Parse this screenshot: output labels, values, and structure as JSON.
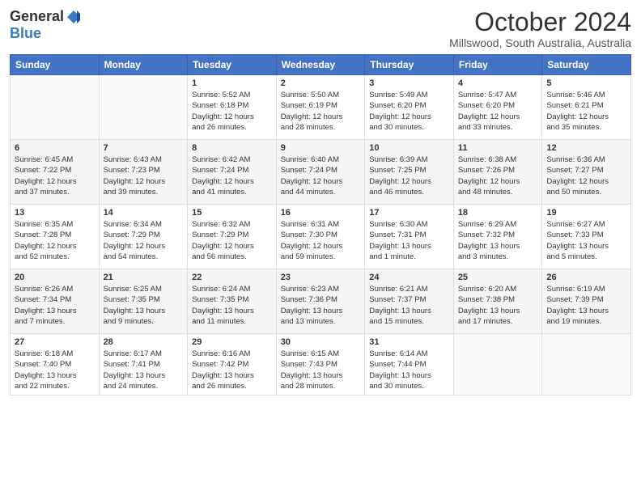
{
  "logo": {
    "general": "General",
    "blue": "Blue"
  },
  "title": "October 2024",
  "location": "Millswood, South Australia, Australia",
  "days_of_week": [
    "Sunday",
    "Monday",
    "Tuesday",
    "Wednesday",
    "Thursday",
    "Friday",
    "Saturday"
  ],
  "weeks": [
    [
      {
        "day": "",
        "info": ""
      },
      {
        "day": "",
        "info": ""
      },
      {
        "day": "1",
        "info": "Sunrise: 5:52 AM\nSunset: 6:18 PM\nDaylight: 12 hours\nand 26 minutes."
      },
      {
        "day": "2",
        "info": "Sunrise: 5:50 AM\nSunset: 6:19 PM\nDaylight: 12 hours\nand 28 minutes."
      },
      {
        "day": "3",
        "info": "Sunrise: 5:49 AM\nSunset: 6:20 PM\nDaylight: 12 hours\nand 30 minutes."
      },
      {
        "day": "4",
        "info": "Sunrise: 5:47 AM\nSunset: 6:20 PM\nDaylight: 12 hours\nand 33 minutes."
      },
      {
        "day": "5",
        "info": "Sunrise: 5:46 AM\nSunset: 6:21 PM\nDaylight: 12 hours\nand 35 minutes."
      }
    ],
    [
      {
        "day": "6",
        "info": "Sunrise: 6:45 AM\nSunset: 7:22 PM\nDaylight: 12 hours\nand 37 minutes."
      },
      {
        "day": "7",
        "info": "Sunrise: 6:43 AM\nSunset: 7:23 PM\nDaylight: 12 hours\nand 39 minutes."
      },
      {
        "day": "8",
        "info": "Sunrise: 6:42 AM\nSunset: 7:24 PM\nDaylight: 12 hours\nand 41 minutes."
      },
      {
        "day": "9",
        "info": "Sunrise: 6:40 AM\nSunset: 7:24 PM\nDaylight: 12 hours\nand 44 minutes."
      },
      {
        "day": "10",
        "info": "Sunrise: 6:39 AM\nSunset: 7:25 PM\nDaylight: 12 hours\nand 46 minutes."
      },
      {
        "day": "11",
        "info": "Sunrise: 6:38 AM\nSunset: 7:26 PM\nDaylight: 12 hours\nand 48 minutes."
      },
      {
        "day": "12",
        "info": "Sunrise: 6:36 AM\nSunset: 7:27 PM\nDaylight: 12 hours\nand 50 minutes."
      }
    ],
    [
      {
        "day": "13",
        "info": "Sunrise: 6:35 AM\nSunset: 7:28 PM\nDaylight: 12 hours\nand 52 minutes."
      },
      {
        "day": "14",
        "info": "Sunrise: 6:34 AM\nSunset: 7:29 PM\nDaylight: 12 hours\nand 54 minutes."
      },
      {
        "day": "15",
        "info": "Sunrise: 6:32 AM\nSunset: 7:29 PM\nDaylight: 12 hours\nand 56 minutes."
      },
      {
        "day": "16",
        "info": "Sunrise: 6:31 AM\nSunset: 7:30 PM\nDaylight: 12 hours\nand 59 minutes."
      },
      {
        "day": "17",
        "info": "Sunrise: 6:30 AM\nSunset: 7:31 PM\nDaylight: 13 hours\nand 1 minute."
      },
      {
        "day": "18",
        "info": "Sunrise: 6:29 AM\nSunset: 7:32 PM\nDaylight: 13 hours\nand 3 minutes."
      },
      {
        "day": "19",
        "info": "Sunrise: 6:27 AM\nSunset: 7:33 PM\nDaylight: 13 hours\nand 5 minutes."
      }
    ],
    [
      {
        "day": "20",
        "info": "Sunrise: 6:26 AM\nSunset: 7:34 PM\nDaylight: 13 hours\nand 7 minutes."
      },
      {
        "day": "21",
        "info": "Sunrise: 6:25 AM\nSunset: 7:35 PM\nDaylight: 13 hours\nand 9 minutes."
      },
      {
        "day": "22",
        "info": "Sunrise: 6:24 AM\nSunset: 7:35 PM\nDaylight: 13 hours\nand 11 minutes."
      },
      {
        "day": "23",
        "info": "Sunrise: 6:23 AM\nSunset: 7:36 PM\nDaylight: 13 hours\nand 13 minutes."
      },
      {
        "day": "24",
        "info": "Sunrise: 6:21 AM\nSunset: 7:37 PM\nDaylight: 13 hours\nand 15 minutes."
      },
      {
        "day": "25",
        "info": "Sunrise: 6:20 AM\nSunset: 7:38 PM\nDaylight: 13 hours\nand 17 minutes."
      },
      {
        "day": "26",
        "info": "Sunrise: 6:19 AM\nSunset: 7:39 PM\nDaylight: 13 hours\nand 19 minutes."
      }
    ],
    [
      {
        "day": "27",
        "info": "Sunrise: 6:18 AM\nSunset: 7:40 PM\nDaylight: 13 hours\nand 22 minutes."
      },
      {
        "day": "28",
        "info": "Sunrise: 6:17 AM\nSunset: 7:41 PM\nDaylight: 13 hours\nand 24 minutes."
      },
      {
        "day": "29",
        "info": "Sunrise: 6:16 AM\nSunset: 7:42 PM\nDaylight: 13 hours\nand 26 minutes."
      },
      {
        "day": "30",
        "info": "Sunrise: 6:15 AM\nSunset: 7:43 PM\nDaylight: 13 hours\nand 28 minutes."
      },
      {
        "day": "31",
        "info": "Sunrise: 6:14 AM\nSunset: 7:44 PM\nDaylight: 13 hours\nand 30 minutes."
      },
      {
        "day": "",
        "info": ""
      },
      {
        "day": "",
        "info": ""
      }
    ]
  ]
}
